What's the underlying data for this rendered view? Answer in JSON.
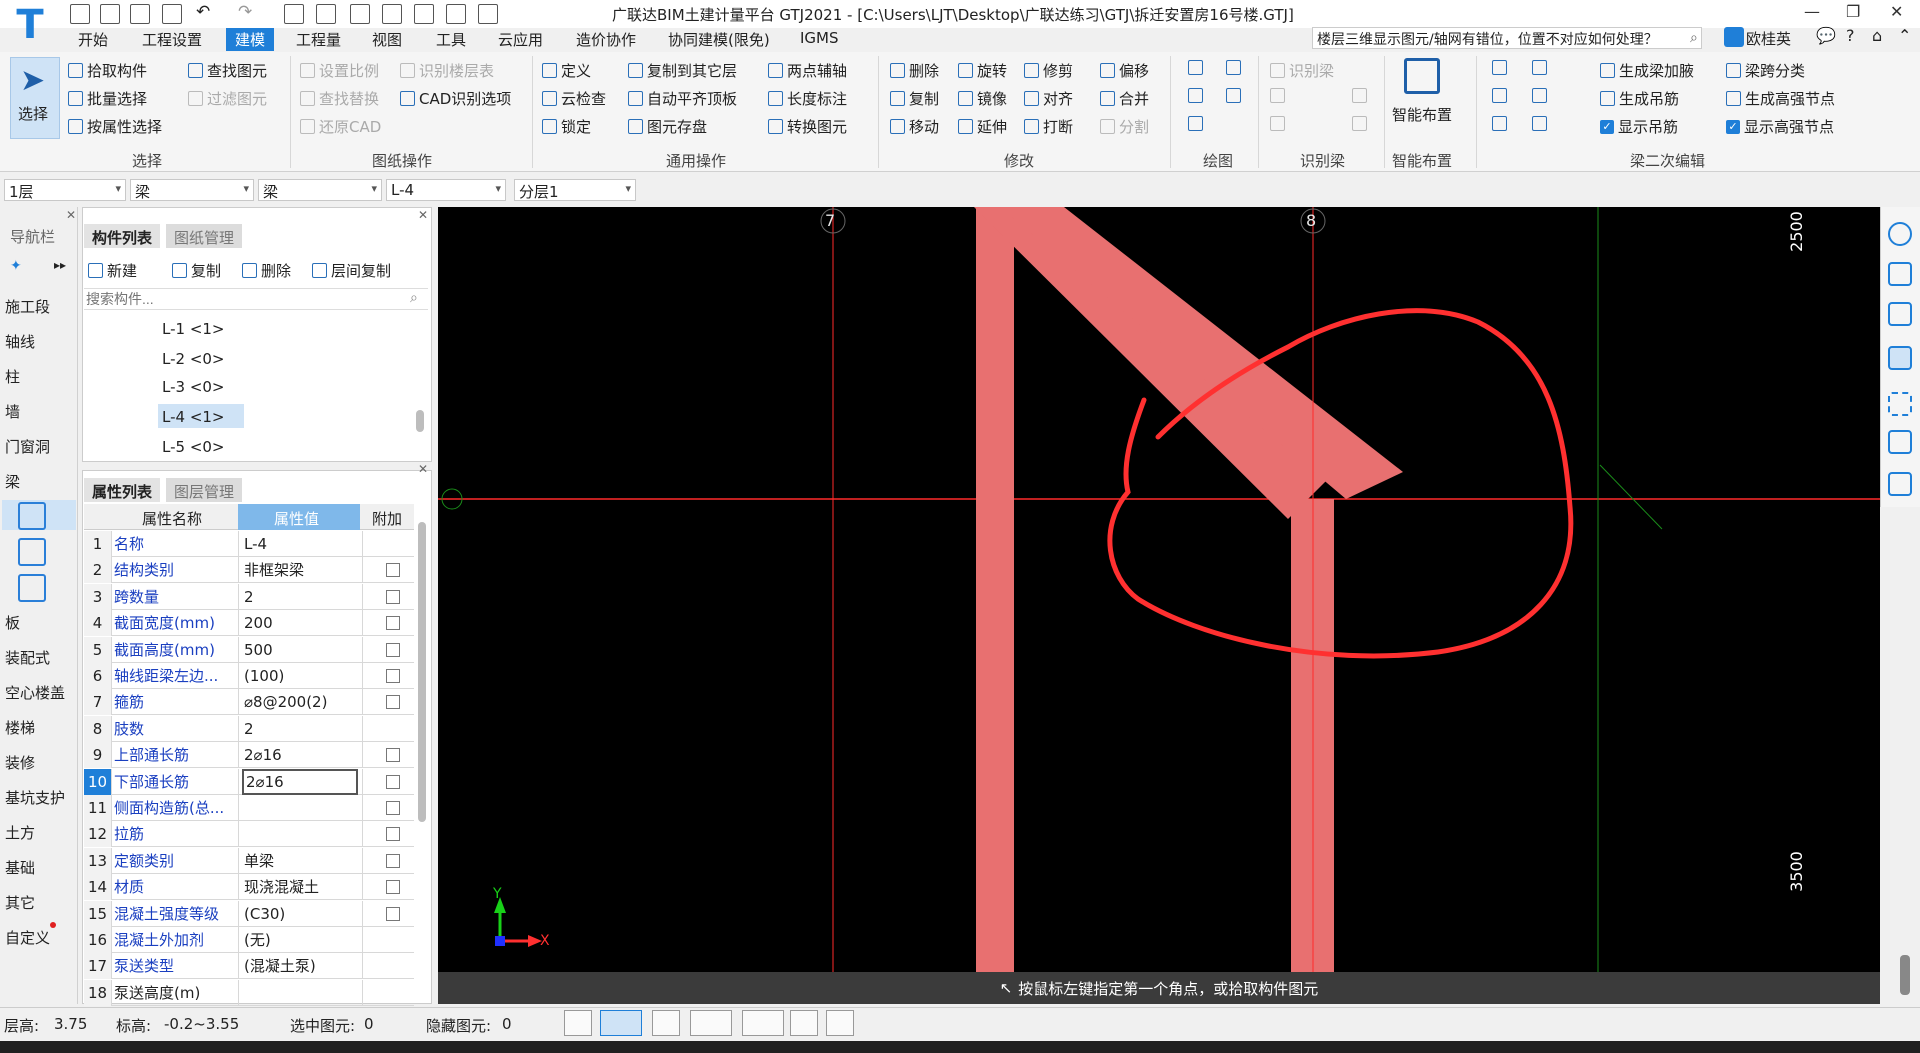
{
  "app": {
    "title": "广联达BIM土建计量平台 GTJ2021 - [C:\\Users\\LJT\\Desktop\\广联达练习\\GTJ\\拆迁安置房16号楼.GTJ]",
    "help_text": "楼层三维显示图元/轴网有错位，位置不对应如何处理？",
    "user": "欧桂英"
  },
  "menu": [
    "开始",
    "工程设置",
    "建模",
    "工程量",
    "视图",
    "工具",
    "云应用",
    "造价协作",
    "协同建模(限免)",
    "IGMS"
  ],
  "menu_active": "建模",
  "ribbon": {
    "select": {
      "label": "选择",
      "pick": "拾取构件",
      "batch": "批量选择",
      "by_attr": "按属性选择",
      "find": "查找图元",
      "filter": "过滤图元",
      "group": "选择"
    },
    "drawing_ops": {
      "set_scale": "设置比例",
      "recognize_floor": "识别楼层表",
      "find_replace": "查找替换",
      "cad_options": "CAD识别选项",
      "restore_cad": "还原CAD",
      "group": "图纸操作"
    },
    "general": {
      "define": "定义",
      "copy_other": "复制到其它层",
      "two_point_axis": "两点辅轴",
      "cloud_check": "云检查",
      "auto_level": "自动平齐顶板",
      "length_mark": "长度标注",
      "lock": "锁定",
      "element_save": "图元存盘",
      "convert": "转换图元",
      "group": "通用操作"
    },
    "modify": {
      "delete": "删除",
      "rotate": "旋转",
      "trim": "修剪",
      "offset": "偏移",
      "copy": "复制",
      "mirror": "镜像",
      "align": "对齐",
      "merge": "合并",
      "move": "移动",
      "extend": "延伸",
      "break": "打断",
      "split": "分割",
      "group": "修改"
    },
    "draw": {
      "group": "绘图"
    },
    "recognize_beam": {
      "label": "识别梁",
      "group": "识别梁"
    },
    "smart": {
      "label": "智能布置",
      "group": "智能布置"
    },
    "beam_edit": {
      "gen_haunch": "生成梁加腋",
      "span_class": "梁跨分类",
      "gen_hanger": "生成吊筋",
      "gen_node": "生成高强节点",
      "show_hanger": "显示吊筋",
      "show_node": "显示高强节点",
      "group": "梁二次编辑"
    }
  },
  "selectors": [
    "1层",
    "梁",
    "梁",
    "L-4",
    "分层1"
  ],
  "nav": {
    "title": "导航栏",
    "items": [
      "施工段",
      "轴线",
      "柱",
      "墙",
      "门窗洞",
      "梁",
      "板",
      "装配式",
      "空心楼盖",
      "楼梯",
      "装修",
      "基坑支护",
      "土方",
      "基础",
      "其它",
      "自定义"
    ]
  },
  "component_list": {
    "tabs": [
      "构件列表",
      "图纸管理"
    ],
    "new": "新建",
    "copy": "复制",
    "delete": "删除",
    "floor_copy": "层间复制",
    "search_placeholder": "搜索构件...",
    "items": [
      "L-1 <1>",
      "L-2 <0>",
      "L-3 <0>",
      "L-4 <1>",
      "L-5 <0>"
    ],
    "selected": "L-4 <1>"
  },
  "properties": {
    "tabs": [
      "属性列表",
      "图层管理"
    ],
    "headers": [
      "属性名称",
      "属性值",
      "附加"
    ],
    "rows": [
      {
        "n": "1",
        "name": "名称",
        "value": "L-4",
        "cb": false
      },
      {
        "n": "2",
        "name": "结构类别",
        "value": "非框架梁",
        "cb": true
      },
      {
        "n": "3",
        "name": "跨数量",
        "value": "2",
        "cb": true
      },
      {
        "n": "4",
        "name": "截面宽度(mm)",
        "value": "200",
        "cb": true
      },
      {
        "n": "5",
        "name": "截面高度(mm)",
        "value": "500",
        "cb": true
      },
      {
        "n": "6",
        "name": "轴线距梁左边...",
        "value": "(100)",
        "cb": true
      },
      {
        "n": "7",
        "name": "箍筋",
        "value": "⌀8@200(2)",
        "cb": true
      },
      {
        "n": "8",
        "name": "肢数",
        "value": "2",
        "cb": false
      },
      {
        "n": "9",
        "name": "上部通长筋",
        "value": "2⌀16",
        "cb": true
      },
      {
        "n": "10",
        "name": "下部通长筋",
        "value": "2⌀16",
        "cb": true
      },
      {
        "n": "11",
        "name": "侧面构造筋(总...",
        "value": "",
        "cb": true
      },
      {
        "n": "12",
        "name": "拉筋",
        "value": "",
        "cb": true
      },
      {
        "n": "13",
        "name": "定额类别",
        "value": "单梁",
        "cb": true
      },
      {
        "n": "14",
        "name": "材质",
        "value": "现浇混凝土",
        "cb": true
      },
      {
        "n": "15",
        "name": "混凝土强度等级",
        "value": "(C30)",
        "cb": true
      },
      {
        "n": "16",
        "name": "混凝土外加剂",
        "value": "(无)",
        "cb": false
      },
      {
        "n": "17",
        "name": "泵送类型",
        "value": "(混凝土泵)",
        "cb": false
      },
      {
        "n": "18",
        "name": "泵送高度(m)",
        "value": "",
        "cb": false
      }
    ]
  },
  "canvas": {
    "axis_labels": [
      "7",
      "8"
    ],
    "dimensions": [
      "2500",
      "3500"
    ],
    "hint": "按鼠标左键指定第一个角点，或拾取构件图元",
    "axis_y": "Y",
    "axis_x": "X",
    "colors": {
      "beam": "#e87070",
      "axis_line": "#ff2a2a",
      "grid_line": "#1a8c1a",
      "annotation": "#ff3030"
    }
  },
  "status": {
    "floor_height_label": "层高:",
    "floor_height": "3.75",
    "elevation_label": "标高:",
    "elevation": "-0.2~3.55",
    "selected_label": "选中图元:",
    "selected": "0",
    "hidden_label": "隐藏图元:",
    "hidden": "0"
  }
}
